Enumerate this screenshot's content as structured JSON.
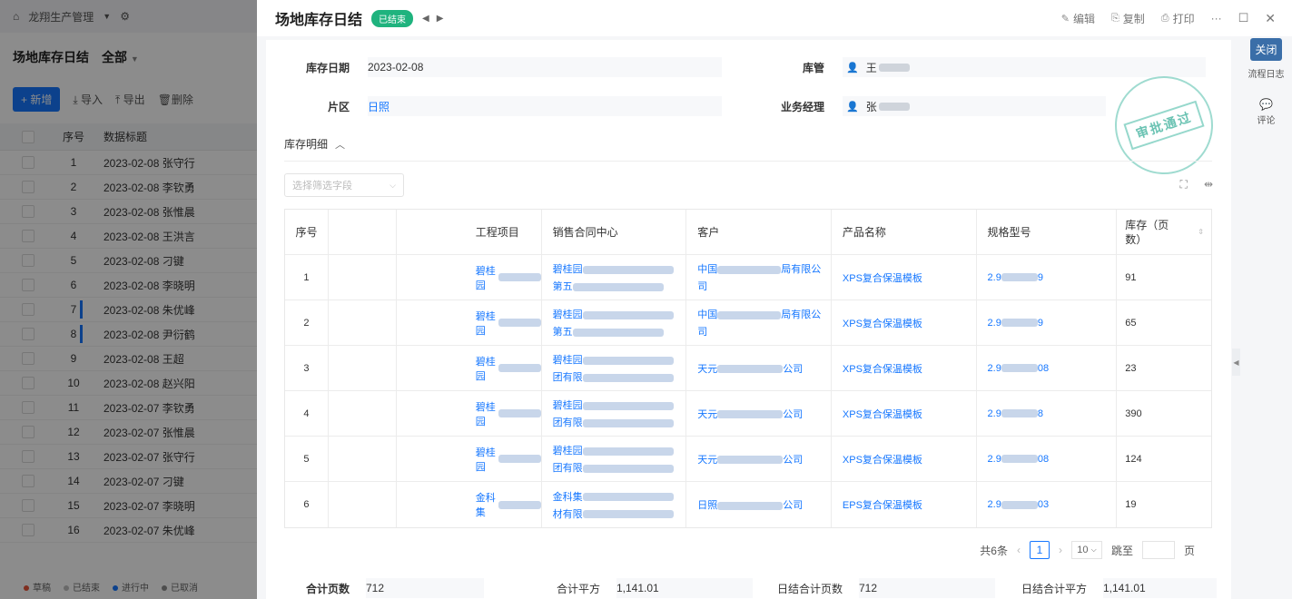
{
  "background_app": {
    "app_name": "龙翔生产管理",
    "page_title": "场地库存日结",
    "view_filter": "全部",
    "toolbar": {
      "new": "+ 新增",
      "import": "导入",
      "export": "导出",
      "delete": "删除"
    },
    "columns": [
      "序号",
      "数据标题"
    ],
    "rows": [
      {
        "no": "1",
        "title": "2023-02-08 张守行",
        "mark": false
      },
      {
        "no": "2",
        "title": "2023-02-08 李钦勇",
        "mark": false
      },
      {
        "no": "3",
        "title": "2023-02-08 张惟晨",
        "mark": false
      },
      {
        "no": "4",
        "title": "2023-02-08 王洪言",
        "mark": false
      },
      {
        "no": "5",
        "title": "2023-02-08 刁键",
        "mark": false
      },
      {
        "no": "6",
        "title": "2023-02-08 李晓明",
        "mark": false
      },
      {
        "no": "7",
        "title": "2023-02-08 朱优峰",
        "mark": true
      },
      {
        "no": "8",
        "title": "2023-02-08 尹衍鹤",
        "mark": true
      },
      {
        "no": "9",
        "title": "2023-02-08 王超",
        "mark": false
      },
      {
        "no": "10",
        "title": "2023-02-08 赵兴阳",
        "mark": false
      },
      {
        "no": "11",
        "title": "2023-02-07 李钦勇",
        "mark": false
      },
      {
        "no": "12",
        "title": "2023-02-07 张惟晨",
        "mark": false
      },
      {
        "no": "13",
        "title": "2023-02-07 张守行",
        "mark": false
      },
      {
        "no": "14",
        "title": "2023-02-07 刁键",
        "mark": false
      },
      {
        "no": "15",
        "title": "2023-02-07 李晓明",
        "mark": false
      },
      {
        "no": "16",
        "title": "2023-02-07 朱优峰",
        "mark": false
      }
    ],
    "legend": [
      {
        "label": "草稿",
        "color": "#e8553a"
      },
      {
        "label": "已结束",
        "color": "#bfbfbf"
      },
      {
        "label": "进行中",
        "color": "#1677ff"
      },
      {
        "label": "已取消",
        "color": "#8c8c8c"
      }
    ]
  },
  "drawer": {
    "title": "场地库存日结",
    "status": "已结束",
    "actions": {
      "edit": "编辑",
      "copy": "复制",
      "print": "打印",
      "more": "···"
    },
    "close_tooltip": "关闭",
    "side": {
      "flow_log": "流程日志",
      "comment": "评论"
    },
    "stamp_text": "审批通过",
    "fields": {
      "date_label": "库存日期",
      "date_value": "2023-02-08",
      "keeper_label": "库管",
      "keeper_value": "王",
      "area_label": "片区",
      "area_value": "日照",
      "manager_label": "业务经理",
      "manager_value": "张"
    },
    "detail": {
      "section_title": "库存明细",
      "filter_placeholder": "选择筛选字段",
      "columns": [
        "序号",
        "",
        "工程项目",
        "销售合同中心",
        "客户",
        "产品名称",
        "规格型号",
        "库存（页数）"
      ],
      "rows": [
        {
          "no": "1",
          "project": "碧桂园",
          "contract": [
            "碧桂园",
            "第五"
          ],
          "customer": [
            "中国",
            "局有限公",
            "司"
          ],
          "product": "XPS复合保温模板",
          "spec": [
            "2.9",
            "9"
          ],
          "stock": "91"
        },
        {
          "no": "2",
          "project": "碧桂园",
          "contract": [
            "碧桂园",
            "第五"
          ],
          "customer": [
            "中国",
            "局有限公",
            "司"
          ],
          "product": "XPS复合保温模板",
          "spec": [
            "2.9",
            "9"
          ],
          "stock": "65"
        },
        {
          "no": "3",
          "project": "碧桂园",
          "contract": [
            "碧桂园",
            "团有限"
          ],
          "customer": [
            "天元",
            "公司",
            ""
          ],
          "product": "XPS复合保温模板",
          "spec": [
            "2.9",
            "08"
          ],
          "stock": "23"
        },
        {
          "no": "4",
          "project": "碧桂园",
          "contract": [
            "碧桂园",
            "团有限"
          ],
          "customer": [
            "天元",
            "公司",
            ""
          ],
          "product": "XPS复合保温模板",
          "spec": [
            "2.9",
            "8"
          ],
          "stock": "390"
        },
        {
          "no": "5",
          "project": "碧桂园",
          "contract": [
            "碧桂园",
            "团有限"
          ],
          "customer": [
            "天元",
            "公司",
            ""
          ],
          "product": "XPS复合保温模板",
          "spec": [
            "2.9",
            "08"
          ],
          "stock": "124"
        },
        {
          "no": "6",
          "project": "金科集",
          "contract": [
            "金科集",
            "材有限"
          ],
          "customer": [
            "日照",
            "公司",
            ""
          ],
          "product": "EPS复合保温模板",
          "spec": [
            "2.9",
            "03"
          ],
          "stock": "19"
        }
      ]
    },
    "pager": {
      "total": "共6条",
      "current": "1",
      "page_size": "10",
      "jump": "跳至",
      "page_unit": "页"
    },
    "summary": {
      "total_pages_label": "合计页数",
      "total_pages_value": "712",
      "total_area_label": "合计平方",
      "total_area_value": "1,141.01",
      "daily_pages_label": "日结合计页数",
      "daily_pages_value": "712",
      "daily_area_label": "日结合计平方",
      "daily_area_value": "1,141.01"
    }
  }
}
